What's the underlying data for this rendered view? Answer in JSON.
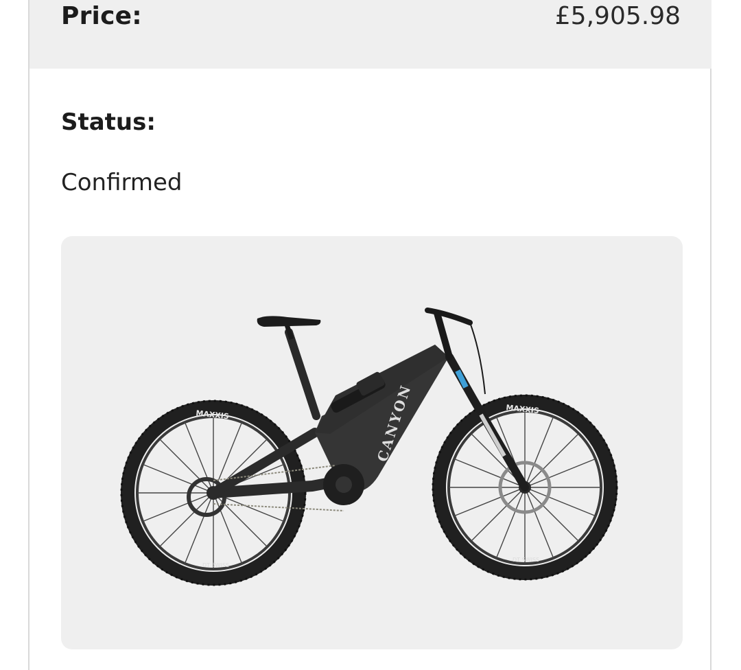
{
  "order": {
    "price_label": "Price:",
    "price_value": "£5,905.98",
    "status_label": "Status:",
    "status_value": "Confirmed"
  },
  "product": {
    "image_icon": "bike-image",
    "brand_logo": "CANYON",
    "tyre_brand": "MAXXIS",
    "rim_brand": "DT SWISS"
  }
}
